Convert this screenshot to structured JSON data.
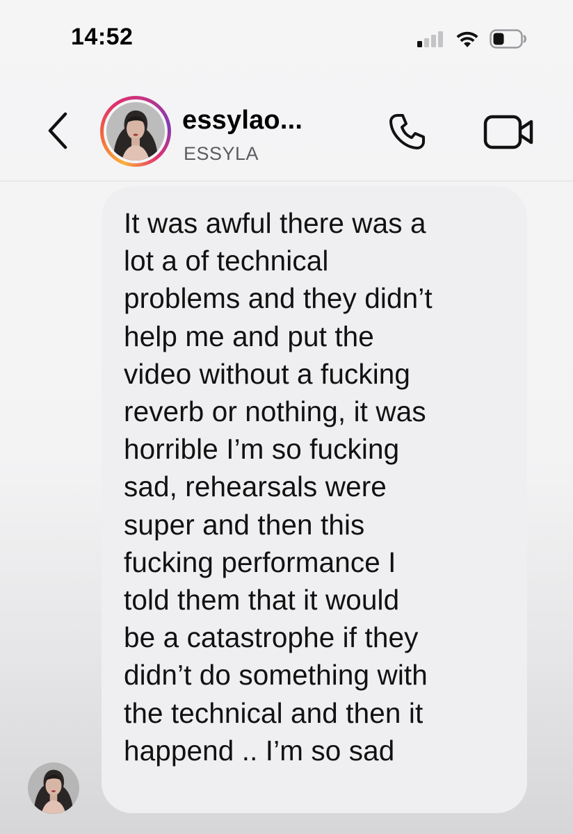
{
  "status_bar": {
    "time": "14:52",
    "icons": [
      "cellular-signal-icon",
      "wifi-icon",
      "battery-icon"
    ]
  },
  "header": {
    "back_icon": "chevron-left-icon",
    "username": "essylao...",
    "display_name": "ESSYLA",
    "call_icon": "phone-icon",
    "video_icon": "video-camera-icon"
  },
  "message": {
    "text": "It was awful there was a\nlot a of technical\nproblems and they didn’t\nhelp me and put the\nvideo without a fucking\nreverb or nothing, it was\nhorrible I’m so fucking\nsad, rehearsals were\nsuper and then this\nfucking performance I\ntold them that it would\nbe a catastrophe if they\ndidn’t do something with\nthe technical and then it\nhappend .. I’m so sad"
  },
  "colors": {
    "background": "#f4f4f5",
    "bubble": "#efeff1",
    "subtitle_gray": "#5c5c60",
    "story_ring": [
      "#fbb03b",
      "#e1306c",
      "#833ab4"
    ]
  }
}
